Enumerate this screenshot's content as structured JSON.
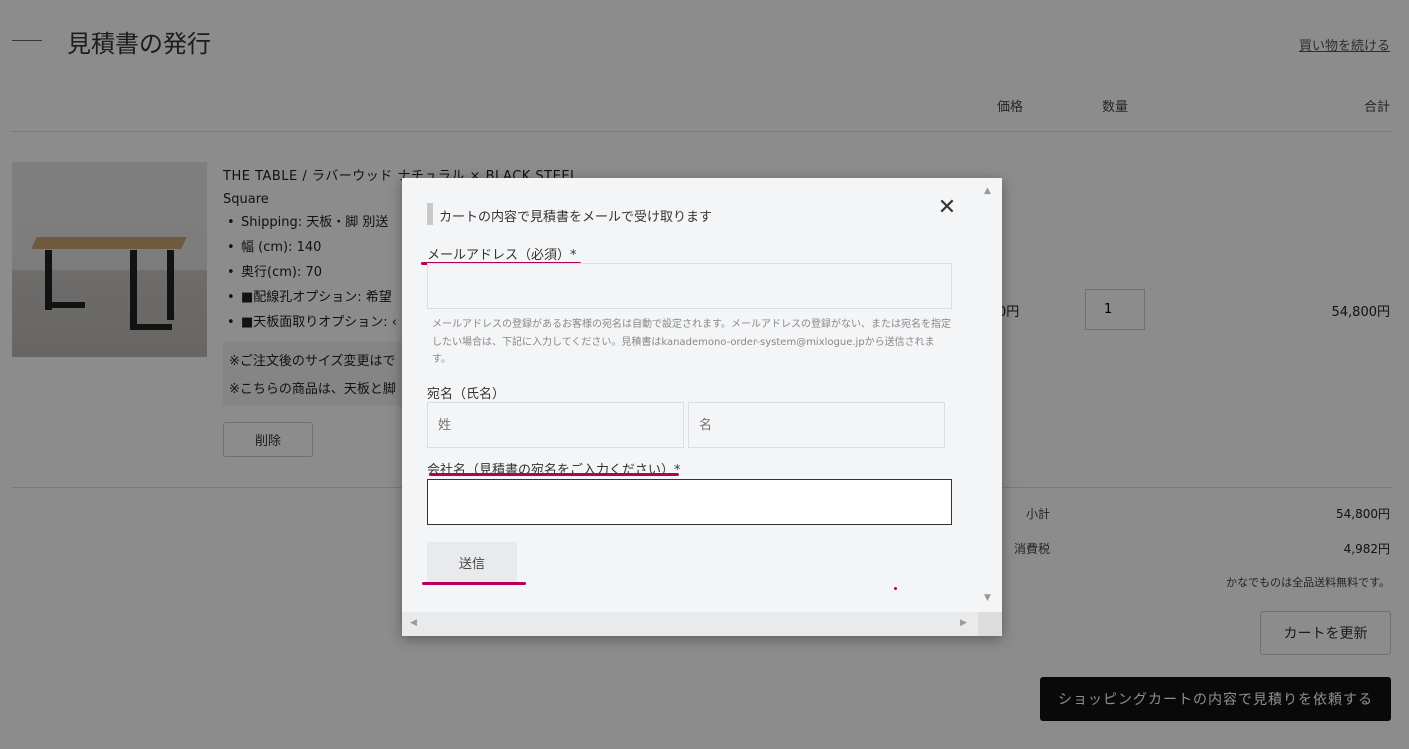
{
  "page": {
    "title": "見積書の発行",
    "continue_link": "買い物を続ける",
    "columns": {
      "price": "価格",
      "quantity": "数量",
      "total": "合計"
    }
  },
  "product": {
    "name": "THE TABLE / ラバーウッド ナチュラル × BLACK STEEL",
    "variant": "Square",
    "options": [
      "Shipping: 天板・脚 別送",
      "幅 (cm): 140",
      "奥行(cm): 70",
      "■配線孔オプション: 希望",
      "■天板面取りオプション: ‹"
    ],
    "notes": [
      "※ご注文後のサイズ変更はで",
      "※こちらの商品は、天板と脚"
    ],
    "delete_label": "削除",
    "price_fragment": "0円",
    "quantity": "1",
    "line_total": "54,800円"
  },
  "summary": {
    "subtotal_label": "小計",
    "subtotal_value": "54,800円",
    "tax_label": "消費税",
    "tax_value": "4,982円",
    "shipping_note": "かなでものは全品送料無料です。",
    "update_label": "カートを更新",
    "checkout_label": "ショッピングカートの内容で見積りを依頼する"
  },
  "modal": {
    "heading": "カートの内容で見積書をメールで受け取ります",
    "close_icon": "close-icon",
    "email_label": "メールアドレス（必須）*",
    "email_value": "",
    "help_text": "メールアドレスの登録があるお客様の宛名は自動で設定されます。メールアドレスの登録がない、または宛名を指定したい場合は、下記に入力してください。見積書はkanademono-order-system@mixlogue.jpから送信されます。",
    "recipient_label": "宛名（氏名）",
    "last_name_placeholder": "姓",
    "first_name_placeholder": "名",
    "company_label": "会社名（見積書の宛名をご入力ください）*",
    "company_value": "",
    "send_label": "送信"
  },
  "colors": {
    "annotation": "#b5005b",
    "overlay": "rgba(0,0,0,0.45)",
    "checkout_bg": "#111111"
  }
}
